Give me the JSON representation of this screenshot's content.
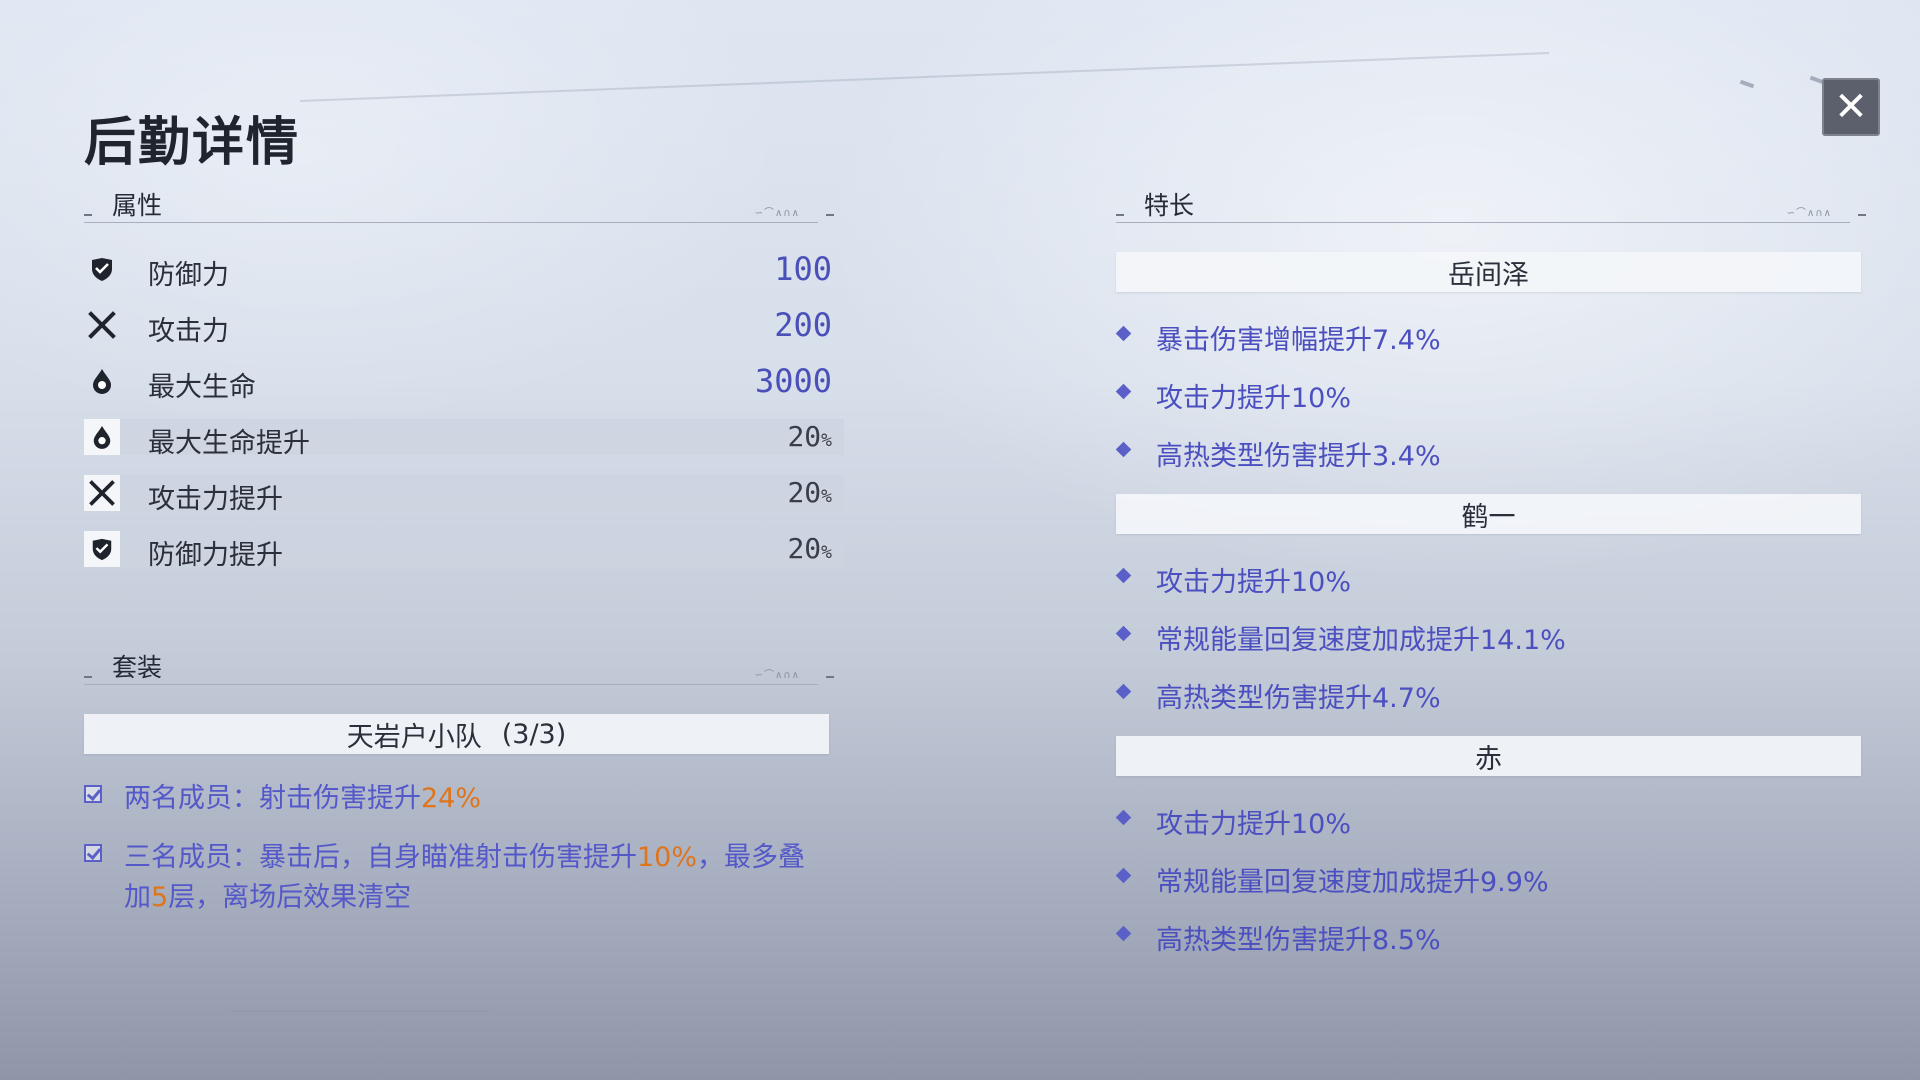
{
  "title": "后勤详情",
  "close_icon": "close-icon",
  "attributes": {
    "header": "属性",
    "header_glyphs": "∽⌒∧∩∧",
    "stats": [
      {
        "icon": "shield-icon",
        "label": "防御力",
        "value": "100"
      },
      {
        "icon": "crossed-swords-icon",
        "label": "攻击力",
        "value": "200"
      },
      {
        "icon": "drop-icon",
        "label": "最大生命",
        "value": "3000"
      }
    ],
    "bonuses": [
      {
        "icon": "drop-icon",
        "label": "最大生命提升",
        "value": "20",
        "unit": "%"
      },
      {
        "icon": "crossed-swords-icon",
        "label": "攻击力提升",
        "value": "20",
        "unit": "%"
      },
      {
        "icon": "shield-icon",
        "label": "防御力提升",
        "value": "20",
        "unit": "%"
      }
    ]
  },
  "set": {
    "header": "套装",
    "header_glyphs": "∽⌒∧∩∧",
    "name": "天岩户小队",
    "count": "(3/3)",
    "effects": [
      {
        "checked": true,
        "prefix": "两名成员：射击伤害提升",
        "highlight": "24%",
        "suffix": ""
      },
      {
        "checked": true,
        "line1_prefix": "三名成员：暴击后，自身瞄准射击伤害提升",
        "line1_highlight": "10%",
        "line1_suffix": "，最多叠",
        "line2_prefix": "加",
        "line2_highlight": "5",
        "line2_suffix": "层，离场后效果清空"
      }
    ]
  },
  "specialties": {
    "header": "特长",
    "header_glyphs": "∽⌒∧∩∧",
    "groups": [
      {
        "name": "岳间泽",
        "perks": [
          "暴击伤害增幅提升7.4%",
          "攻击力提升10%",
          "高热类型伤害提升3.4%"
        ]
      },
      {
        "name": "鹤一",
        "perks": [
          "攻击力提升10%",
          "常规能量回复速度加成提升14.1%",
          "高热类型伤害提升4.7%"
        ]
      },
      {
        "name": "赤",
        "perks": [
          "攻击力提升10%",
          "常规能量回复速度加成提升9.9%",
          "高热类型伤害提升8.5%"
        ]
      }
    ]
  },
  "colors": {
    "accent_blue": "#4b4fc0",
    "highlight_orange": "#e0741a"
  }
}
